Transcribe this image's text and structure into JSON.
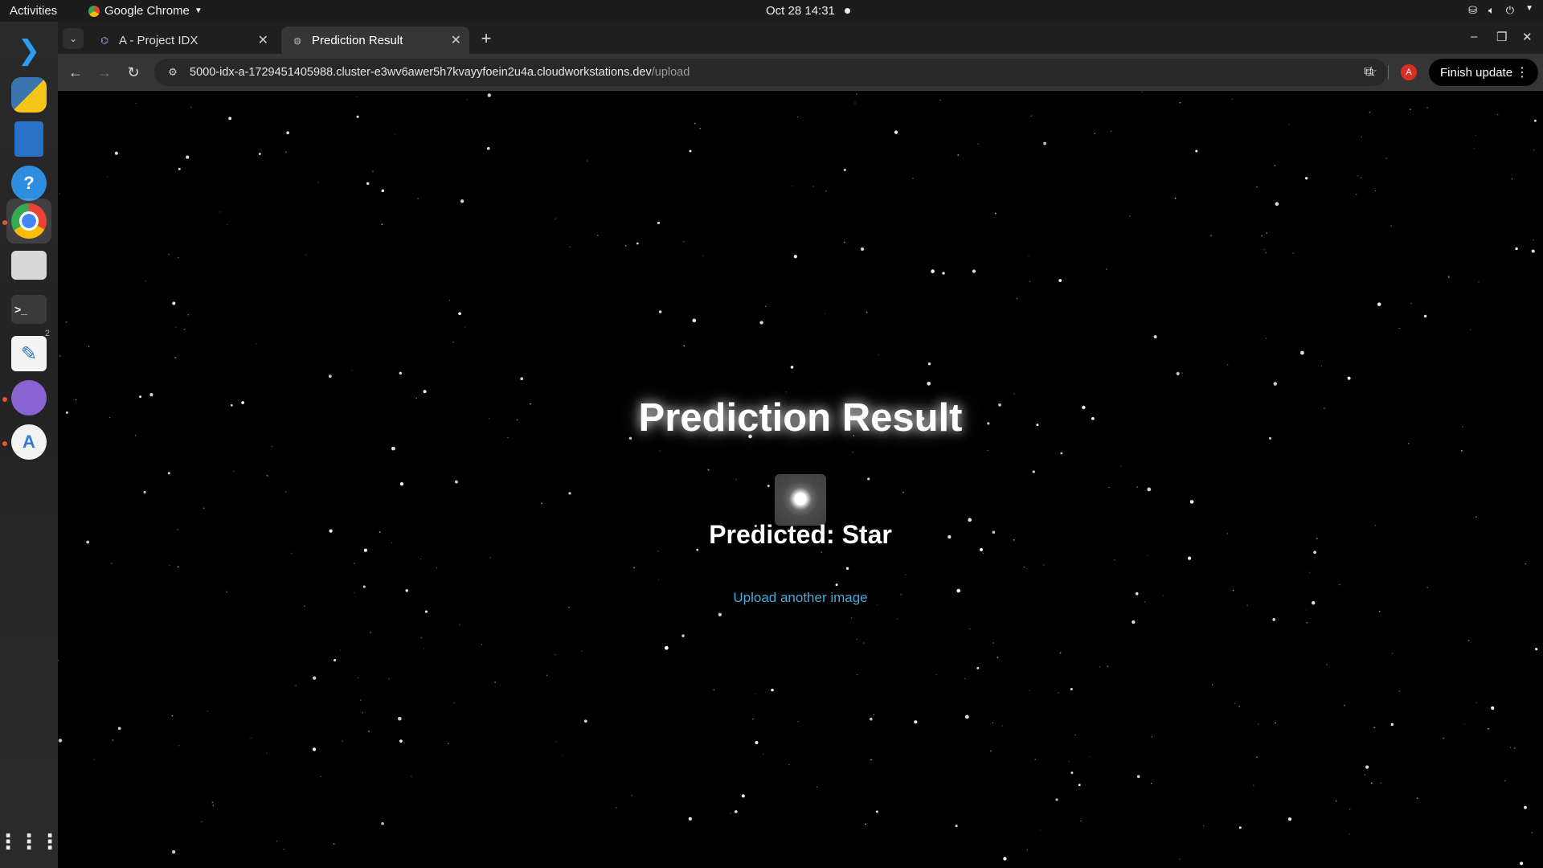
{
  "topbar": {
    "activities": "Activities",
    "app_name": "Google Chrome",
    "clock": "Oct 28  14:31"
  },
  "dock": {
    "items": [
      "vscode-icon",
      "python-icon",
      "document-viewer-icon",
      "help-icon",
      "chrome-icon",
      "files-icon",
      "terminal-icon",
      "text-editor-icon",
      "network-app-icon",
      "app-store-icon",
      "show-apps-icon"
    ],
    "terminal_badge": "2"
  },
  "browser": {
    "tabs": [
      {
        "title": "A - Project IDX",
        "active": false
      },
      {
        "title": "Prediction Result",
        "active": true
      }
    ],
    "url_host": "5000-idx-a-1729451405988.cluster-e3wv6awer5h7kvayyfoein2u4a.cloudworkstations.dev",
    "url_path": "/upload",
    "profile_initial": "A",
    "finish_update_label": "Finish update"
  },
  "page": {
    "title": "Prediction Result",
    "predicted_label": "Predicted: Star",
    "upload_link": "Upload another image"
  },
  "colors": {
    "link": "#4aa8d8",
    "profile": "#d93025",
    "background": "#000000"
  }
}
